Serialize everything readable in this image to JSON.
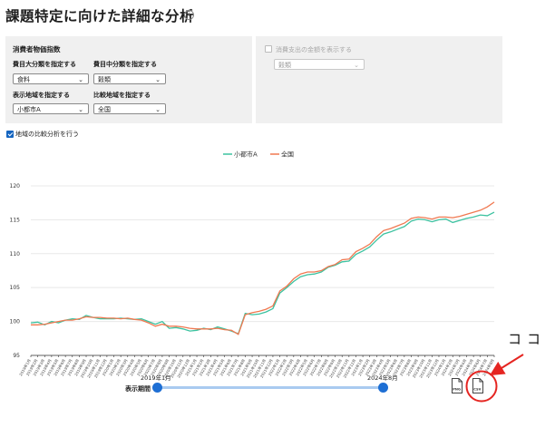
{
  "page": {
    "title": "課題特定に向けた詳細な分析",
    "info_icon": "info-icon"
  },
  "controls": {
    "section_title": "消費者物価指数",
    "major_category": {
      "label": "費目大分類を指定する",
      "value": "食料"
    },
    "middle_category": {
      "label": "費目中分類を指定する",
      "value": "穀類"
    },
    "region": {
      "label": "表示地域を指定する",
      "value": "小都市A"
    },
    "compare_region": {
      "label": "比較地域を指定する",
      "value": "全国"
    },
    "spending_toggle": {
      "label": "消費支出の金額を表示する",
      "checked": false
    },
    "spending_select": {
      "value": "穀類",
      "disabled": true
    },
    "compare_toggle": {
      "label": "地域の比較分析を行う",
      "checked": true
    }
  },
  "chart_data": {
    "type": "line",
    "title": "",
    "xlabel": "",
    "ylabel": "",
    "ylim": [
      95,
      122
    ],
    "yticks": [
      95,
      100,
      105,
      110,
      115,
      120
    ],
    "grid": true,
    "legend_position": "top-center",
    "x": [
      "2019年1月",
      "2019年2月",
      "2019年3月",
      "2019年4月",
      "2019年5月",
      "2019年6月",
      "2019年7月",
      "2019年8月",
      "2019年9月",
      "2019年10月",
      "2019年11月",
      "2019年12月",
      "2020年1月",
      "2020年2月",
      "2020年3月",
      "2020年4月",
      "2020年5月",
      "2020年6月",
      "2020年7月",
      "2020年8月",
      "2020年9月",
      "2020年10月",
      "2020年11月",
      "2020年12月",
      "2021年1月",
      "2021年2月",
      "2021年3月",
      "2021年4月",
      "2021年5月",
      "2021年6月",
      "2021年7月",
      "2021年8月",
      "2021年9月",
      "2021年10月",
      "2021年11月",
      "2021年12月",
      "2022年1月",
      "2022年2月",
      "2022年3月",
      "2022年4月",
      "2022年5月",
      "2022年6月",
      "2022年7月",
      "2022年8月",
      "2022年9月",
      "2022年10月",
      "2022年11月",
      "2022年12月",
      "2023年1月",
      "2023年2月",
      "2023年3月",
      "2023年4月",
      "2023年5月",
      "2023年6月",
      "2023年7月",
      "2023年8月",
      "2023年9月",
      "2023年10月",
      "2023年11月",
      "2023年12月",
      "2024年1月",
      "2024年2月",
      "2024年3月",
      "2024年4月",
      "2024年5月",
      "2024年6月",
      "2024年7月",
      "2024年8月"
    ],
    "series": [
      {
        "name": "小都市A",
        "color": "#3cc2a0",
        "values": [
          99.8,
          99.9,
          99.5,
          100.0,
          99.8,
          100.2,
          100.4,
          100.3,
          100.9,
          100.6,
          100.4,
          100.4,
          100.4,
          100.5,
          100.4,
          100.3,
          100.4,
          100.0,
          99.6,
          100.0,
          99.0,
          99.1,
          98.9,
          98.6,
          98.7,
          99.0,
          98.8,
          99.2,
          98.9,
          98.6,
          98.2,
          101.2,
          101.0,
          101.1,
          101.4,
          101.9,
          104.2,
          105.0,
          105.9,
          106.6,
          106.9,
          107.0,
          107.3,
          108.0,
          108.3,
          108.8,
          108.9,
          109.9,
          110.4,
          111.0,
          112.0,
          112.9,
          113.2,
          113.6,
          114.0,
          114.8,
          115.1,
          115.0,
          114.7,
          115.0,
          115.1,
          114.6,
          114.9,
          115.2,
          115.4,
          115.7,
          115.6,
          116.1
        ]
      },
      {
        "name": "全国",
        "color": "#f07850",
        "values": [
          99.5,
          99.5,
          99.6,
          99.8,
          100.0,
          100.2,
          100.2,
          100.4,
          100.7,
          100.6,
          100.6,
          100.5,
          100.5,
          100.4,
          100.5,
          100.3,
          100.2,
          99.8,
          99.3,
          99.6,
          99.3,
          99.3,
          99.2,
          99.0,
          98.9,
          98.9,
          98.9,
          99.0,
          98.8,
          98.7,
          98.1,
          101.0,
          101.3,
          101.5,
          101.8,
          102.3,
          104.5,
          105.2,
          106.3,
          107.0,
          107.3,
          107.3,
          107.5,
          108.1,
          108.4,
          109.1,
          109.2,
          110.3,
          110.8,
          111.4,
          112.5,
          113.4,
          113.7,
          114.1,
          114.5,
          115.2,
          115.4,
          115.3,
          115.1,
          115.4,
          115.4,
          115.3,
          115.5,
          115.8,
          116.1,
          116.4,
          116.9,
          117.6
        ]
      }
    ]
  },
  "range": {
    "label": "表示期間",
    "start": "2019年1月",
    "end": "2024年8月"
  },
  "downloads": {
    "png": "PNG",
    "csv": "CSV"
  },
  "annotation": {
    "text": "ココ"
  }
}
